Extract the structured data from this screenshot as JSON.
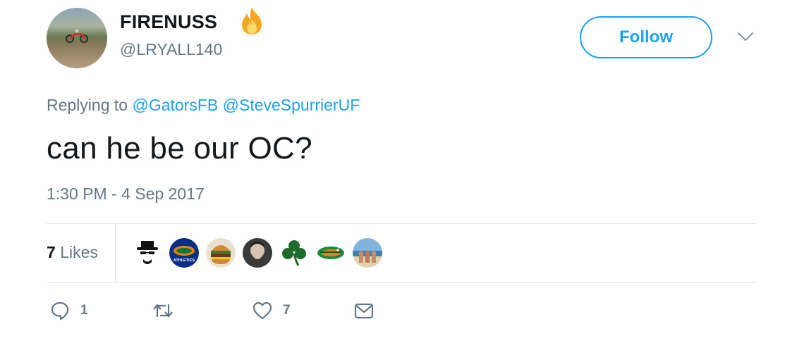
{
  "user": {
    "display_name": "FIRENUSS",
    "emoji": "fire-emoji",
    "handle": "@LRYALL140"
  },
  "header": {
    "follow_label": "Follow",
    "menu_icon": "chevron-down-icon"
  },
  "reply": {
    "prefix": "Replying to",
    "mentions": [
      "@GatorsFB",
      "@SteveSpurrierUF"
    ]
  },
  "tweet": {
    "text": "can he be our OC?",
    "timestamp": "1:30 PM - 4 Sep 2017"
  },
  "stats": {
    "likes_count": "7",
    "likes_label": "Likes",
    "liker_avatars": [
      "heisenberg-avatar",
      "gators-athletics-avatar",
      "burger-avatar",
      "bearded-man-avatar",
      "shamrock-avatar",
      "gator-logo-avatar",
      "beach-group-avatar"
    ],
    "gators_text": "ATHLETICS"
  },
  "actions": {
    "reply_count": "1",
    "retweet_count": "",
    "like_count": "7",
    "icons": [
      "reply-icon",
      "retweet-icon",
      "heart-icon",
      "direct-message-icon"
    ]
  },
  "colors": {
    "accent": "#1da1f2",
    "secondary_text": "#657786",
    "divider": "#e1e8ed"
  }
}
